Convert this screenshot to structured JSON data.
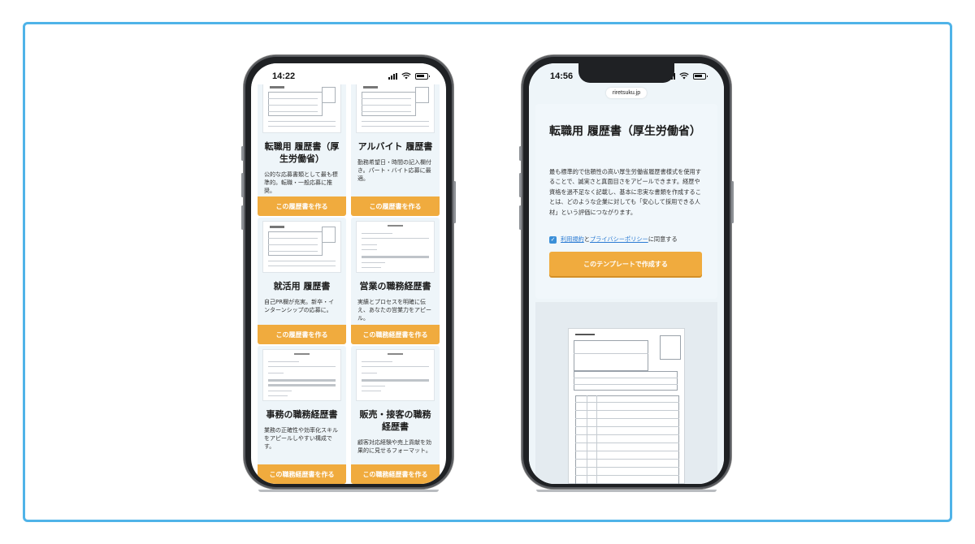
{
  "left_phone": {
    "time": "14:22",
    "cards": [
      {
        "title": "転職用 履歴書（厚生労働省）",
        "desc": "公的な応募書類として最も標準的。転職・一般応募に推奨。",
        "button": "この履歴書を作る",
        "thumb": "resume"
      },
      {
        "title": "アルバイト 履歴書",
        "desc": "勤務希望日・時間の記入欄付き。パート・バイト応募に最適。",
        "button": "この履歴書を作る",
        "thumb": "resume"
      },
      {
        "title": "就活用 履歴書",
        "desc": "自己PR欄が充実。新卒・インターンシップの応募に。",
        "button": "この履歴書を作る",
        "thumb": "resume"
      },
      {
        "title": "営業の職務経歴書",
        "desc": "実績とプロセスを明確に伝え、あなたの営業力をアピール。",
        "button": "この職務経歴書を作る",
        "thumb": "cv"
      },
      {
        "title": "事務の職務経歴書",
        "desc": "業務の正確性や効率化スキルをアピールしやすい構成です。",
        "button": "この職務経歴書を作る",
        "thumb": "cv"
      },
      {
        "title": "販売・接客の職務経歴書",
        "desc": "顧客対応経験や売上貢献を効果的に見せるフォーマット。",
        "button": "この職務経歴書を作る",
        "thumb": "cv"
      }
    ]
  },
  "right_phone": {
    "time": "14:56",
    "url": "riretsuku.jp",
    "title": "転職用 履歴書（厚生労働省）",
    "description": "最も標準的で信頼性の高い厚生労働省履歴書様式を使用することで、誠実さと真面目さをアピールできます。経歴や資格を過不足なく記載し、基本に忠実な書類を作成することは、どのような企業に対しても「安心して採用できる人材」という評価につながります。",
    "agree": {
      "terms_link": "利用規約",
      "and": "と",
      "privacy_link": "プライバシーポリシー",
      "suffix": "に同意する",
      "checked": true
    },
    "cta": "このテンプレートで作成する"
  },
  "colors": {
    "frame_border": "#4fb3e8",
    "accent_orange": "#f0ab3e",
    "card_bg": "#eef5f9",
    "link_blue": "#2b7bd3"
  }
}
